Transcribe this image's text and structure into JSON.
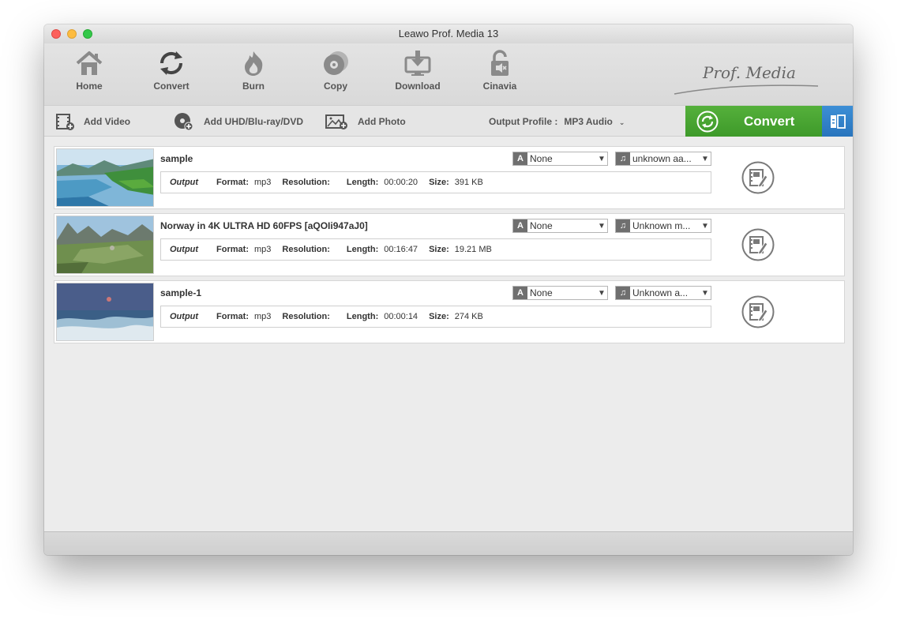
{
  "window": {
    "title": "Leawo Prof. Media 13"
  },
  "toolbar": {
    "items": [
      {
        "label": "Home",
        "icon": "home-icon"
      },
      {
        "label": "Convert",
        "icon": "convert-icon"
      },
      {
        "label": "Burn",
        "icon": "burn-icon"
      },
      {
        "label": "Copy",
        "icon": "copy-icon"
      },
      {
        "label": "Download",
        "icon": "download-icon"
      },
      {
        "label": "Cinavia",
        "icon": "cinavia-icon"
      }
    ],
    "brand": "Prof. Media"
  },
  "actions": {
    "add_video": "Add Video",
    "add_uhd": "Add UHD/Blu-ray/DVD",
    "add_photo": "Add Photo",
    "output_profile_label": "Output Profile :",
    "output_profile_value": "MP3 Audio",
    "convert_label": "Convert"
  },
  "output_labels": {
    "output": "Output",
    "format": "Format:",
    "resolution": "Resolution:",
    "length": "Length:",
    "size": "Size:"
  },
  "files": [
    {
      "title": "sample",
      "subtitle": "None",
      "audio": "unknown aa...",
      "format": "mp3",
      "resolution": "",
      "length": "00:00:20",
      "size": "391 KB"
    },
    {
      "title": "Norway in 4K ULTRA HD 60FPS [aQOIi947aJ0]",
      "subtitle": "None",
      "audio": "Unknown m...",
      "format": "mp3",
      "resolution": "",
      "length": "00:16:47",
      "size": "19.21 MB"
    },
    {
      "title": "sample-1",
      "subtitle": "None",
      "audio": "Unknown a...",
      "format": "mp3",
      "resolution": "",
      "length": "00:00:14",
      "size": "274 KB"
    }
  ],
  "colors": {
    "convert_green": "#4aa534",
    "panel_blue": "#2f7fc9"
  }
}
